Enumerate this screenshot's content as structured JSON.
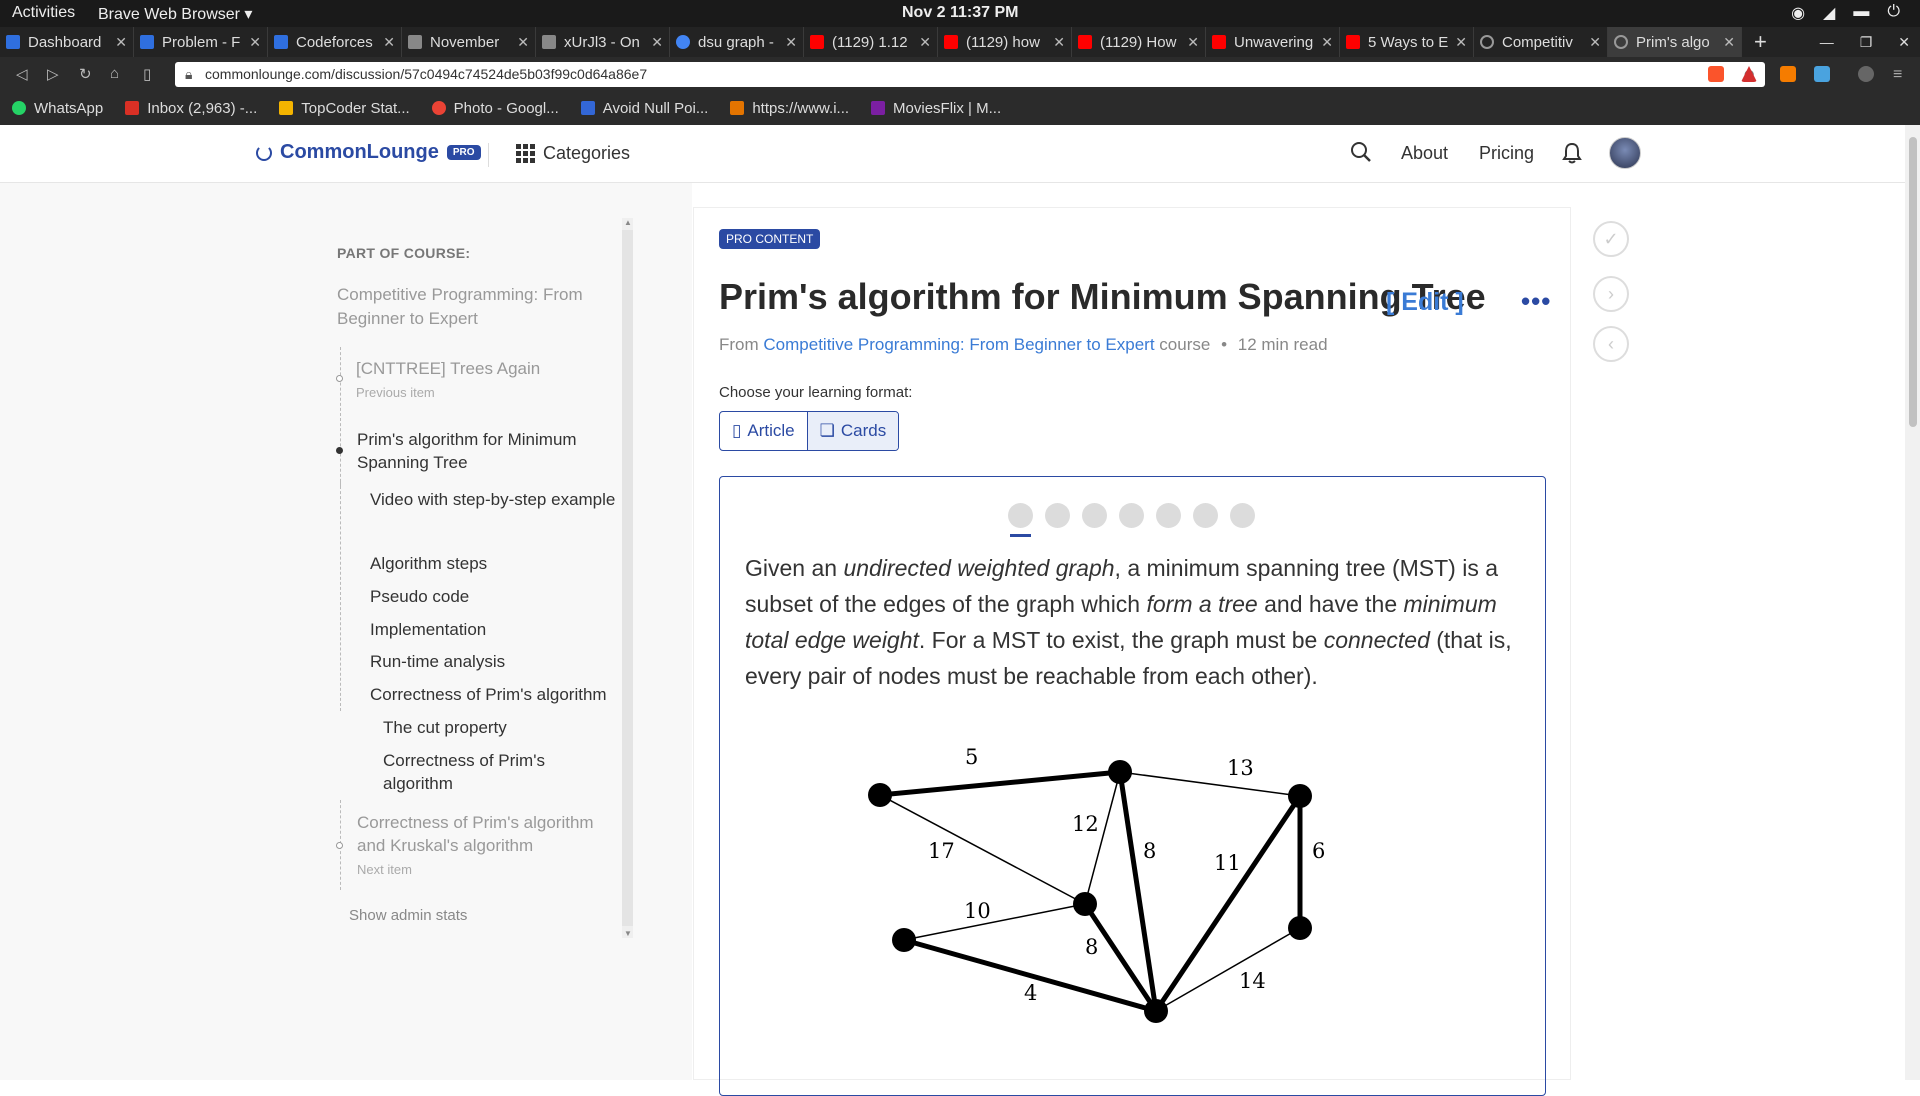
{
  "system_bar": {
    "activities": "Activities",
    "app_name": "Brave Web Browser ▾",
    "clock": "Nov 2  11:37 PM"
  },
  "tabs": [
    {
      "label": "Dashboard",
      "color": "#2f6fdf",
      "active": false
    },
    {
      "label": "Problem - F",
      "color": "#2f6fdf",
      "active": false
    },
    {
      "label": "Codeforces",
      "color": "#2f6fdf",
      "active": false
    },
    {
      "label": "November",
      "color": "#888888",
      "active": false
    },
    {
      "label": "xUrJl3 - On",
      "color": "#888888",
      "active": false
    },
    {
      "label": "dsu graph -",
      "color": "#4285f4",
      "active": false
    },
    {
      "label": "(1129) 1.12",
      "color": "#ff0000",
      "active": false
    },
    {
      "label": "(1129) how",
      "color": "#ff0000",
      "active": false
    },
    {
      "label": "(1129) How",
      "color": "#ff0000",
      "active": false
    },
    {
      "label": "Unwavering",
      "color": "#ff0000",
      "active": false
    },
    {
      "label": "5 Ways to E",
      "color": "#ff0000",
      "active": false
    },
    {
      "label": "Competitiv",
      "color": "#666666",
      "active": false
    },
    {
      "label": "Prim's algo",
      "color": "#666666",
      "active": true
    }
  ],
  "address_bar": {
    "url": "commonlounge.com/discussion/57c0494c74524de5b03f99c0d64a86e7"
  },
  "bookmarks": [
    {
      "label": "WhatsApp",
      "color": "#25d366"
    },
    {
      "label": "Inbox (2,963) -...",
      "color": "#d93025"
    },
    {
      "label": "TopCoder Stat...",
      "color": "#f4b400"
    },
    {
      "label": "Photo - Googl...",
      "color": "#ea4335"
    },
    {
      "label": "Avoid Null Poi...",
      "color": "#3367d6"
    },
    {
      "label": "https://www.i...",
      "color": "#e37400"
    },
    {
      "label": "MoviesFlix | M...",
      "color": "#7b1fa2"
    }
  ],
  "site_header": {
    "logo": "CommonLounge",
    "pro_badge": "PRO",
    "categories": "Categories",
    "about": "About",
    "pricing": "Pricing"
  },
  "sidebar": {
    "part_of_course": "PART OF COURSE:",
    "course_title": "Competitive Programming: From Beginner to Expert",
    "previous_item": "[CNTTREE] Trees Again",
    "previous_label": "Previous item",
    "current_item": "Prim's algorithm for Minimum Spanning Tree",
    "sections": [
      "Video with step-by-step example",
      "Algorithm steps",
      "Pseudo code",
      "Implementation",
      "Run-time analysis",
      "Correctness of Prim's algorithm"
    ],
    "subsections": [
      "The cut property",
      "Correctness of Prim's algorithm"
    ],
    "next_item": "Correctness of Prim's algorithm and Kruskal's algorithm",
    "next_label": "Next item",
    "admin_stats": "Show admin stats"
  },
  "article": {
    "pro_content": "PRO CONTENT",
    "title": "Prim's algorithm for Minimum Spanning Tree",
    "edit": "[ Edit ]",
    "from": "From",
    "course_link": "Competitive Programming: From Beginner to Expert",
    "course_word": "course",
    "read_time": "12 min read",
    "choose_format": "Choose your learning format:",
    "format_article": "Article",
    "format_cards": "Cards",
    "slide_count": 7,
    "current_slide": 1
  },
  "paragraph": {
    "p1": "Given an ",
    "e1": "undirected weighted graph",
    "p2": ", a minimum spanning tree (MST) is a subset of the edges of the graph which ",
    "e2": "form a tree",
    "p3": " and have the ",
    "e3": "minimum total edge weight",
    "p4": ". For a MST to exist, the graph must be ",
    "e4": "connected",
    "p5": " (that is, every pair of nodes must be reachable from each other)."
  },
  "graph_labels": {
    "w5": "5",
    "w13": "13",
    "w17": "17",
    "w12": "12",
    "w8a": "8",
    "w11": "11",
    "w6": "6",
    "w10": "10",
    "w8b": "8",
    "w4": "4",
    "w14": "14"
  }
}
